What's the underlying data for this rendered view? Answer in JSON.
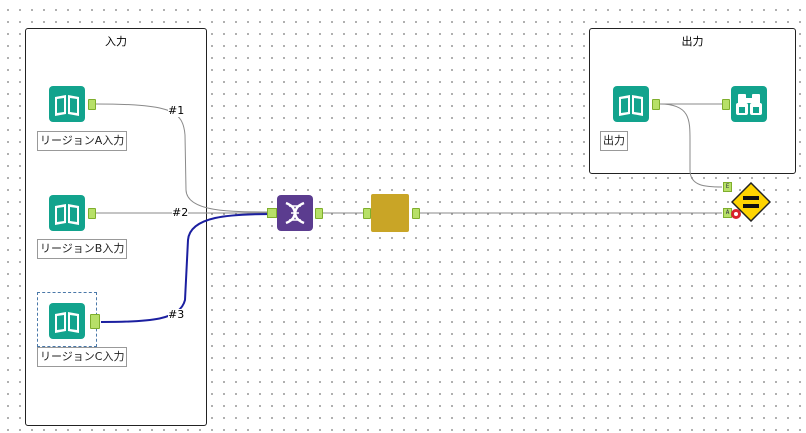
{
  "canvas": {
    "containers": {
      "input_title": "入力",
      "output_title": "出力"
    },
    "tools": {
      "input_a_label": "リージョンA入力",
      "input_b_label": "リージョンB入力",
      "input_c_label": "リージョンC入力",
      "output_label": "出力"
    },
    "connections": {
      "conn_1": "#1",
      "conn_2": "#2",
      "conn_3": "#3"
    },
    "anchors": {
      "e": "E",
      "a": "A"
    },
    "colors": {
      "input_tool": "#12a38d",
      "union_tool": "#5b3c8f",
      "formula_tool": "#c9a526",
      "test_tool": "#ffd400",
      "selected_wire": "#1b1fa0"
    },
    "icons": {
      "input": "book-icon",
      "union": "dna-icon",
      "formula": "blank-tool-icon",
      "browse": "binoculars-icon",
      "test": "equals-diamond-icon"
    }
  }
}
